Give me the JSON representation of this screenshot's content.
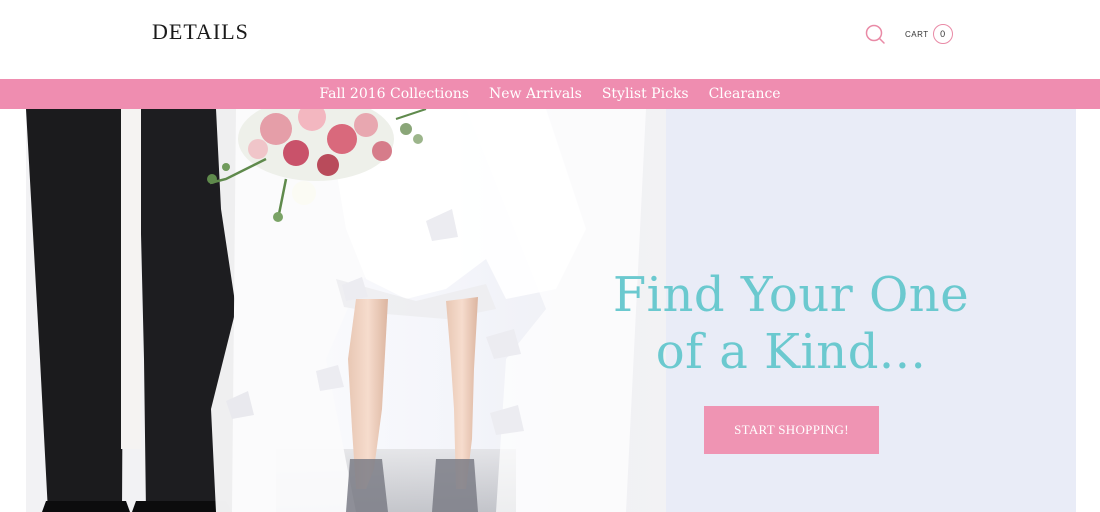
{
  "header": {
    "logo": "DETAILS",
    "search_icon": "search-icon",
    "cart_label": "CART",
    "cart_count": "0"
  },
  "nav": {
    "items": [
      {
        "label": "Fall 2016 Collections"
      },
      {
        "label": "New Arrivals"
      },
      {
        "label": "Stylist Picks"
      },
      {
        "label": "Clearance"
      }
    ]
  },
  "hero": {
    "headline_line1": "Find Your One",
    "headline_line2": "of a Kind...",
    "cta_label": "START SHOPPING!"
  },
  "colors": {
    "accent_pink": "#ef8db0",
    "headline_teal": "#6bc9cf",
    "hero_background": "#e9ecf7"
  }
}
